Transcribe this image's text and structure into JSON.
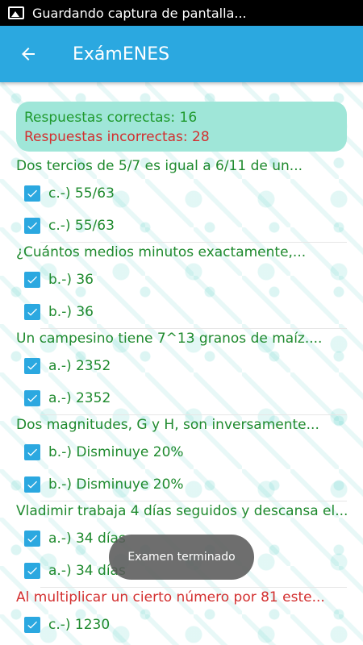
{
  "status_bar": {
    "notification": "Guardando captura de pantalla..."
  },
  "app_bar": {
    "title": "ExámENES",
    "back_icon": "arrow-left-icon"
  },
  "summary": {
    "correct": "Respuestas correctas: 16",
    "incorrect": "Respuestas incorrectas: 28"
  },
  "colors": {
    "accent": "#2BA8E0",
    "correct": "#1F8A2E",
    "incorrect": "#D32F2F",
    "summary_bg": "#9FE6D8"
  },
  "questions": [
    {
      "text": "Dos tercios de 5/7 es igual a 6/11 de un...",
      "status": "correct",
      "answers": [
        "c.-) 55/63",
        "c.-) 55/63"
      ]
    },
    {
      "text": "¿Cuántos medios minutos exactamente,...",
      "status": "correct",
      "answers": [
        "b.-) 36",
        "b.-) 36"
      ]
    },
    {
      "text": "Un campesino tiene 7^13 granos de maíz....",
      "status": "correct",
      "answers": [
        "a.-) 2352",
        "a.-) 2352"
      ]
    },
    {
      "text": "Dos magnitudes, G y H, son inversamente...",
      "status": "correct",
      "answers": [
        "b.-) Disminuye 20%",
        "b.-) Disminuye 20%"
      ]
    },
    {
      "text": "Vladimir trabaja 4 días seguidos y descansa el...",
      "status": "correct",
      "answers": [
        "a.-) 34 días",
        "a.-) 34 días"
      ]
    },
    {
      "text": "Al multiplicar un cierto número por 81 este...",
      "status": "incorrect",
      "answers": [
        "c.-) 1230"
      ]
    }
  ],
  "toast": {
    "message": "Examen terminado"
  }
}
